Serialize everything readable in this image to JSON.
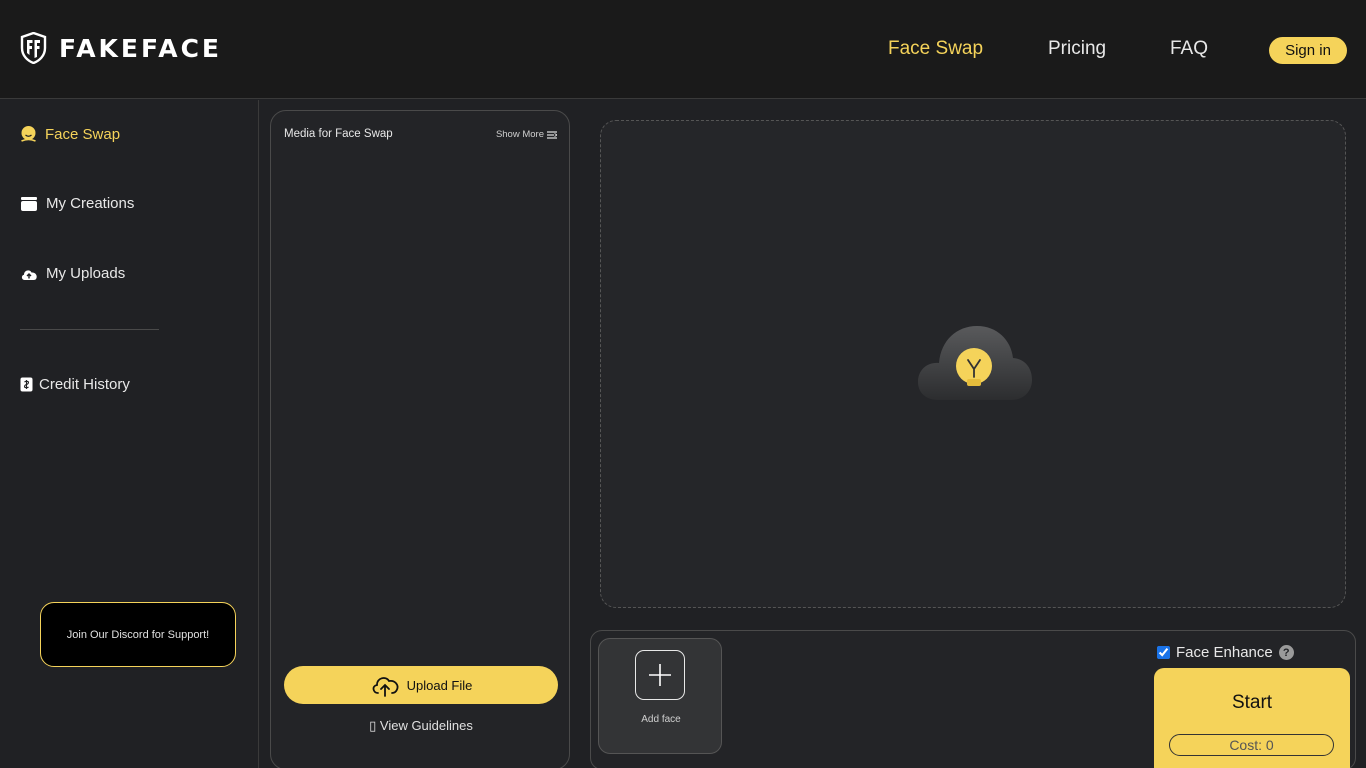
{
  "header": {
    "logo_text": "FAKEFACE",
    "nav": [
      "Face Swap",
      "Pricing",
      "FAQ"
    ],
    "signin_label": "Sign in"
  },
  "sidebar": {
    "items": [
      {
        "label": "Face Swap",
        "icon": "face-icon"
      },
      {
        "label": "My Creations",
        "icon": "folder-icon"
      },
      {
        "label": "My Uploads",
        "icon": "cloud-upload-icon"
      },
      {
        "label": "Credit History",
        "icon": "receipt-icon"
      }
    ],
    "discord_label": "Join Our Discord for Support!"
  },
  "media": {
    "title": "Media for Face Swap",
    "show_more": "Show More",
    "upload_label": "Upload File",
    "guidelines_label": "▯ View Guidelines"
  },
  "bottom": {
    "add_face_label": "Add face",
    "enhance_label": "Face Enhance",
    "enhance_checked": true,
    "help": "?",
    "start_label": "Start",
    "cost_label": "Cost: 0"
  },
  "colors": {
    "accent": "#f5d35a",
    "background": "#202124",
    "topbar": "#1a1a1a"
  }
}
